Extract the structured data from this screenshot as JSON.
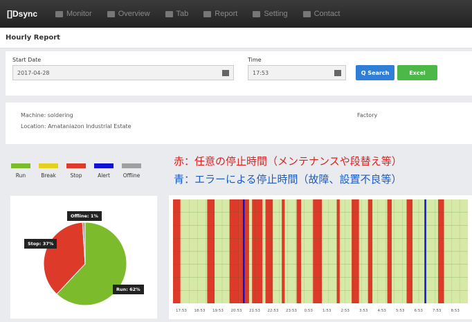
{
  "nav": {
    "brand": "[]Dsync",
    "items": [
      {
        "label": "Monitor",
        "icon": "eye-icon"
      },
      {
        "label": "Overview",
        "icon": "grid-icon"
      },
      {
        "label": "Tab",
        "icon": "tab-icon"
      },
      {
        "label": "Report",
        "icon": "report-icon"
      },
      {
        "label": "Setting",
        "icon": "gear-icon"
      },
      {
        "label": "Contact",
        "icon": "phone-icon"
      }
    ]
  },
  "page": {
    "title": "Hourly Report"
  },
  "form": {
    "start_label": "Start Date",
    "start_value": "2017-04-28",
    "time_label": "Time",
    "time_value": "17:53",
    "search_label": "Q Search",
    "excel_label": "Excel"
  },
  "info": {
    "machine": "Machine: soldering",
    "location": "Location:  Amataniazon Industrial Estate",
    "factory_label": "Factory"
  },
  "legend": [
    {
      "label": "Run",
      "color": "#7cbb2c"
    },
    {
      "label": "Break",
      "color": "#e6d01e"
    },
    {
      "label": "Stop",
      "color": "#dd3a2a"
    },
    {
      "label": "Alert",
      "color": "#1010d8"
    },
    {
      "label": "Offline",
      "color": "#a0a0a0"
    }
  ],
  "annotations": {
    "red": "赤：任意の停止時間（メンテナンスや段替え等）",
    "blue": "青：エラーによる停止時間（故障、設置不良等）"
  },
  "chart_data": {
    "type": "pie",
    "slices": [
      {
        "label": "Run",
        "value": 62,
        "color": "#7cbb2c"
      },
      {
        "label": "Stop",
        "value": 37,
        "color": "#dd3a2a"
      },
      {
        "label": "Offline",
        "value": 1,
        "color": "#a0a0a0"
      }
    ],
    "tooltips": [
      "Offline: 1%",
      "Stop: 37%",
      "Run: 62%"
    ]
  },
  "timeline": {
    "start": "#d6e9a6",
    "segments": [
      {
        "c": "#dd3a2a",
        "w": 2.5
      },
      {
        "c": "#d6e9a6",
        "w": 9
      },
      {
        "c": "#dd3a2a",
        "w": 2.5
      },
      {
        "c": "#d6e9a6",
        "w": 5
      },
      {
        "c": "#dd3a2a",
        "w": 3.5
      },
      {
        "c": "#dd3a2a",
        "w": 1
      },
      {
        "c": "#1010d8",
        "w": 0.6
      },
      {
        "c": "#dd3a2a",
        "w": 1.5
      },
      {
        "c": "#d6e9a6",
        "w": 1
      },
      {
        "c": "#dd3a2a",
        "w": 3.5
      },
      {
        "c": "#d6e9a6",
        "w": 1
      },
      {
        "c": "#dd3a2a",
        "w": 2.5
      },
      {
        "c": "#d6e9a6",
        "w": 3
      },
      {
        "c": "#dd3a2a",
        "w": 1
      },
      {
        "c": "#d6e9a6",
        "w": 4
      },
      {
        "c": "#dd3a2a",
        "w": 1.5
      },
      {
        "c": "#d6e9a6",
        "w": 4
      },
      {
        "c": "#dd3a2a",
        "w": 3
      },
      {
        "c": "#d6e9a6",
        "w": 5
      },
      {
        "c": "#dd3a2a",
        "w": 1
      },
      {
        "c": "#d6e9a6",
        "w": 4
      },
      {
        "c": "#dd3a2a",
        "w": 2.5
      },
      {
        "c": "#d6e9a6",
        "w": 3
      },
      {
        "c": "#dd3a2a",
        "w": 1.5
      },
      {
        "c": "#d6e9a6",
        "w": 5
      },
      {
        "c": "#dd3a2a",
        "w": 1.5
      },
      {
        "c": "#d6e9a6",
        "w": 5
      },
      {
        "c": "#dd3a2a",
        "w": 2
      },
      {
        "c": "#d6e9a6",
        "w": 4
      },
      {
        "c": "#1010d8",
        "w": 0.6
      },
      {
        "c": "#d6e9a6",
        "w": 4
      },
      {
        "c": "#dd3a2a",
        "w": 2
      },
      {
        "c": "#d6e9a6",
        "w": 8
      }
    ],
    "ticks": [
      "17:53",
      "18:53",
      "19:53",
      "20:53",
      "21:53",
      "22:53",
      "23:53",
      "0:53",
      "1:53",
      "2:53",
      "3:53",
      "4:53",
      "5:53",
      "6:53",
      "7:53",
      "8:53"
    ]
  }
}
